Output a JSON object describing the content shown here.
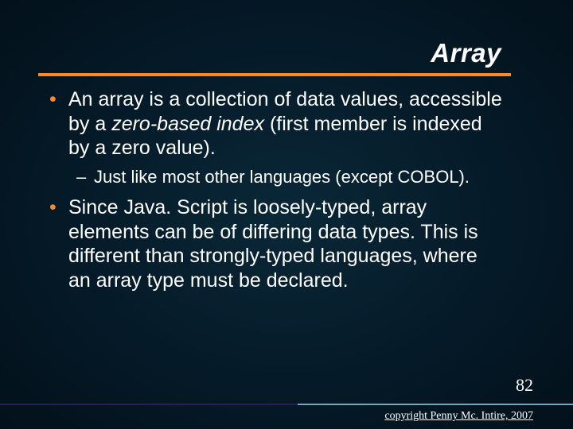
{
  "slide": {
    "title": "Array",
    "bullets": [
      {
        "pre": "An array is a collection of data values, accessible by a ",
        "emph": "zero-based index",
        "post": " (first member is indexed by a zero value).",
        "sub": [
          "Just like most other languages (except COBOL)."
        ]
      },
      {
        "pre": "Since Java. Script is loosely-typed, array elements can be of differing data types. This is different than strongly-typed languages, where an array type must be declared.",
        "emph": "",
        "post": "",
        "sub": []
      }
    ],
    "page_number": "82",
    "copyright": "copyright Penny Mc. Intire, 2007"
  }
}
